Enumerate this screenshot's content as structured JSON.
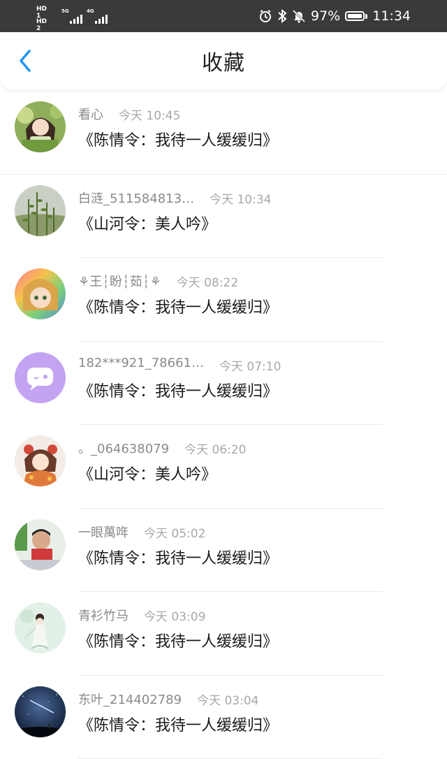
{
  "status_bar": {
    "left_badges": [
      "HD 1",
      "HD 2"
    ],
    "sim1_network": "5G",
    "sim2_network": "4G",
    "battery_percent": "97%",
    "battery_level": 0.97,
    "time": "11:34",
    "icons": [
      "alarm-icon",
      "bluetooth-icon",
      "mute-icon",
      "battery-icon"
    ]
  },
  "header": {
    "title": "收藏",
    "back_icon": "chevron-left-icon",
    "accent": "#2196f3"
  },
  "items": [
    {
      "name": "看心",
      "time": "今天 10:45",
      "work": "《陈情令：我待一人缓缓归》",
      "avatar": "anime-girl"
    },
    {
      "name": "白涟_511584813…",
      "time": "今天 10:34",
      "work": "《山河令：美人吟》",
      "avatar": "plants"
    },
    {
      "name": "⚘王┆盼┆茹┆⚘",
      "time": "今天 08:22",
      "work": "《陈情令：我待一人缓缓归》",
      "avatar": "rainbow-anime"
    },
    {
      "name": "182***921_78661…",
      "time": "今天 07:10",
      "work": "《陈情令：我待一人缓缓归》",
      "avatar": "chat-bubble"
    },
    {
      "name": "。_064638079",
      "time": "今天 06:20",
      "work": "《山河令：美人吟》",
      "avatar": "anime-girl-red"
    },
    {
      "name": "一眼萬哖",
      "time": "今天 05:02",
      "work": "《陈情令：我待一人缓缓归》",
      "avatar": "child-photo"
    },
    {
      "name": "青衫竹马",
      "time": "今天 03:09",
      "work": "《陈情令：我待一人缓缓归》",
      "avatar": "ancient-lady"
    },
    {
      "name": "东叶_214402789",
      "time": "今天 03:04",
      "work": "《陈情令：我待一人缓缓归》",
      "avatar": "night-sky"
    }
  ]
}
